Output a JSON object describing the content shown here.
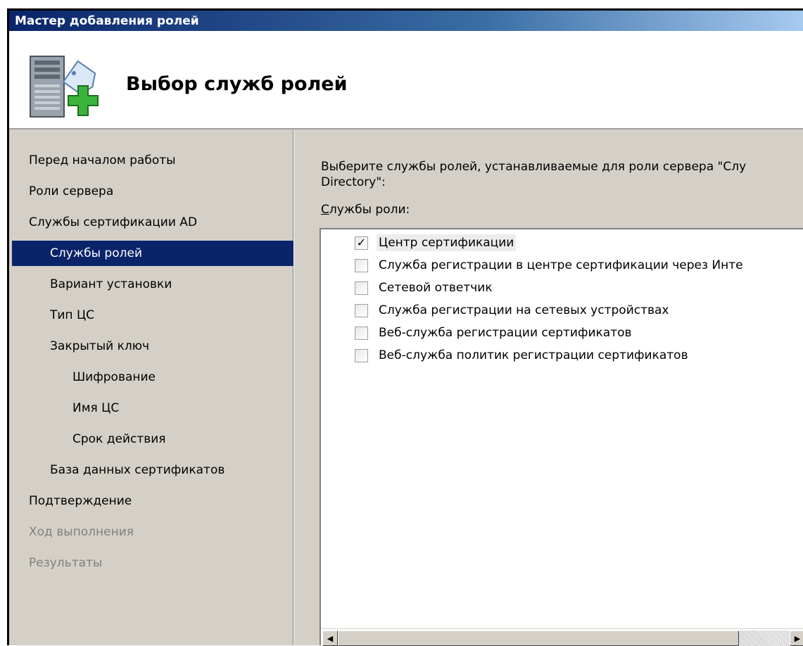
{
  "window": {
    "title": "Мастер добавления ролей"
  },
  "header": {
    "heading": "Выбор служб ролей",
    "icon": "server-add-icon"
  },
  "nav": {
    "items": [
      {
        "label": "Перед началом работы",
        "level": 0,
        "state": "normal"
      },
      {
        "label": "Роли сервера",
        "level": 0,
        "state": "normal"
      },
      {
        "label": "Службы сертификации AD",
        "level": 0,
        "state": "normal"
      },
      {
        "label": "Службы ролей",
        "level": 1,
        "state": "selected"
      },
      {
        "label": "Вариант установки",
        "level": 1,
        "state": "normal"
      },
      {
        "label": "Тип ЦС",
        "level": 1,
        "state": "normal"
      },
      {
        "label": "Закрытый ключ",
        "level": 1,
        "state": "normal"
      },
      {
        "label": "Шифрование",
        "level": 2,
        "state": "normal"
      },
      {
        "label": "Имя ЦС",
        "level": 2,
        "state": "normal"
      },
      {
        "label": "Срок действия",
        "level": 2,
        "state": "normal"
      },
      {
        "label": "База данных сертификатов",
        "level": 1,
        "state": "normal"
      },
      {
        "label": "Подтверждение",
        "level": 0,
        "state": "normal"
      },
      {
        "label": "Ход выполнения",
        "level": 0,
        "state": "disabled"
      },
      {
        "label": "Результаты",
        "level": 0,
        "state": "disabled"
      }
    ]
  },
  "content": {
    "instruction": "Выберите службы ролей, устанавливаемые для роли сервера \"Слу\nDirectory\":",
    "list_label_access": "С",
    "list_label_rest": "лужбы роли:",
    "services": [
      {
        "label": "Центр сертификации",
        "checked": true,
        "focused": true
      },
      {
        "label": "Служба регистрации в центре сертификации через Инте",
        "checked": false,
        "focused": false
      },
      {
        "label": "Сетевой ответчик",
        "checked": false,
        "focused": false
      },
      {
        "label": "Служба регистрации на сетевых устройствах",
        "checked": false,
        "focused": false
      },
      {
        "label": "Веб-служба регистрации сертификатов",
        "checked": false,
        "focused": false
      },
      {
        "label": "Веб-служба политик регистрации сертификатов",
        "checked": false,
        "focused": false
      }
    ],
    "scroll_left_glyph": "◀",
    "scroll_right_glyph": "▶",
    "check_glyph": "✓"
  },
  "colors": {
    "selection": "#0a246a",
    "panel": "#d4d0c8",
    "disabled_text": "#808080"
  }
}
